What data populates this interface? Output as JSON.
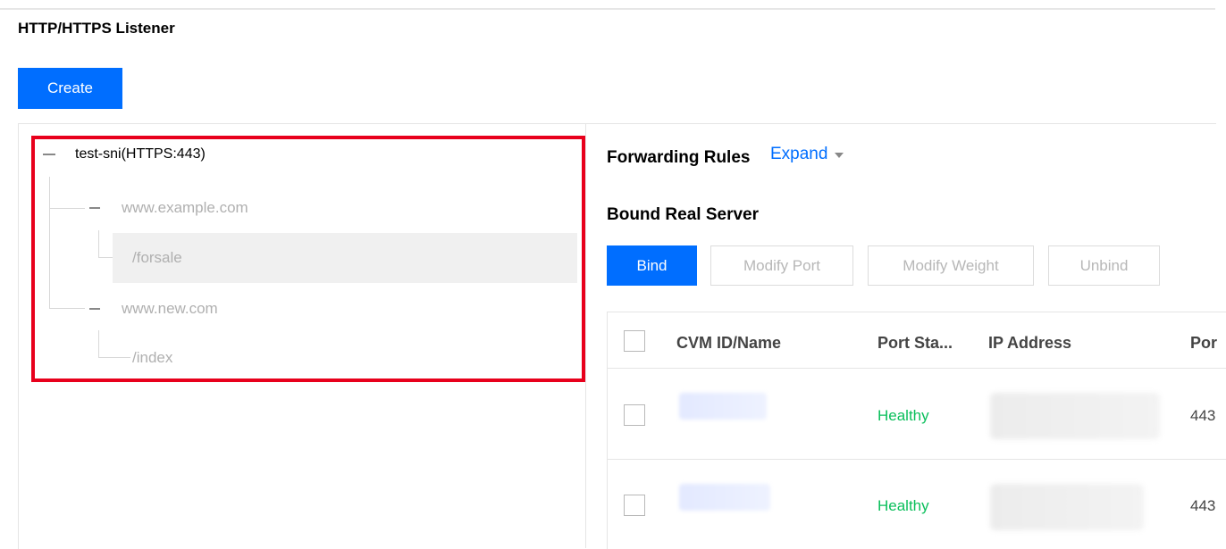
{
  "page": {
    "title": "HTTP/HTTPS Listener"
  },
  "toolbar": {
    "create_label": "Create"
  },
  "tree": {
    "root": {
      "label": "test-sni(HTTPS:443)"
    },
    "domains": [
      {
        "label": "www.example.com",
        "paths": [
          "/forsale"
        ]
      },
      {
        "label": "www.new.com",
        "paths": [
          "/index"
        ]
      }
    ],
    "selected_path": "/forsale"
  },
  "forwarding_rules": {
    "title": "Forwarding Rules",
    "expand_label": "Expand"
  },
  "bound_real_server": {
    "title": "Bound Real Server",
    "actions": {
      "bind": "Bind",
      "modify_port": "Modify Port",
      "modify_weight": "Modify Weight",
      "unbind": "Unbind"
    },
    "table": {
      "columns": [
        "CVM ID/Name",
        "Port Sta...",
        "IP Address",
        "Por"
      ],
      "rows": [
        {
          "status": "Healthy",
          "port": "443"
        },
        {
          "status": "Healthy",
          "port": "443"
        }
      ]
    }
  },
  "colors": {
    "primary": "#006eff",
    "healthy": "#0abf5b",
    "highlight_border": "#e8001c"
  }
}
